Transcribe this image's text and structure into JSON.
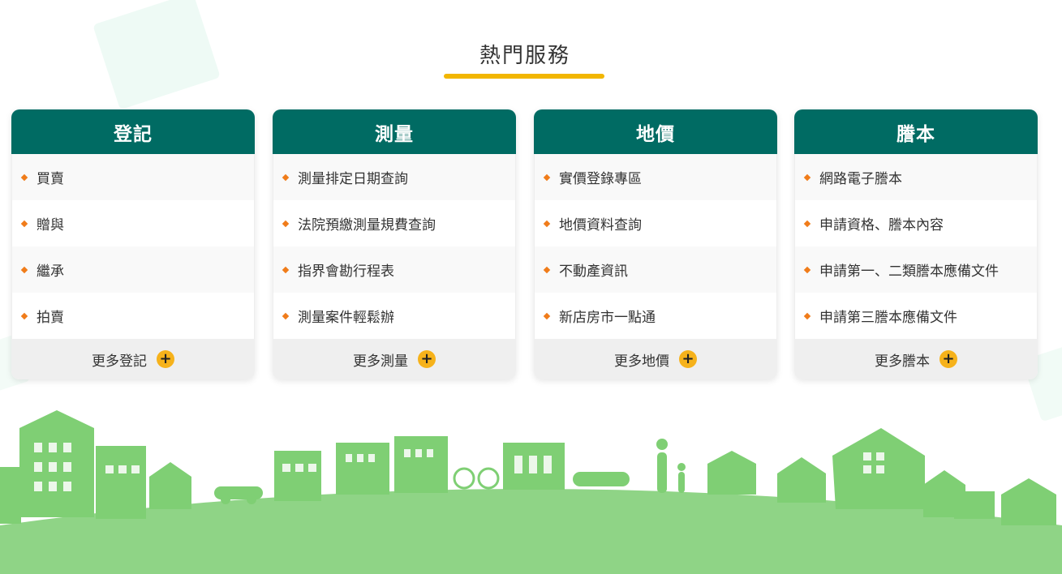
{
  "section": {
    "title": "熱門服務"
  },
  "colors": {
    "header": "#006b63",
    "accent": "#f2b600",
    "bullet": "#f07c1a",
    "plus": "#f6b21b"
  },
  "cards": [
    {
      "title": "登記",
      "items": [
        "買賣",
        "贈與",
        "繼承",
        "拍賣"
      ],
      "more": "更多登記"
    },
    {
      "title": "測量",
      "items": [
        "測量排定日期查詢",
        "法院預繳測量規費查詢",
        "指界會勘行程表",
        "測量案件輕鬆辦"
      ],
      "more": "更多測量"
    },
    {
      "title": "地價",
      "items": [
        "實價登錄專區",
        "地價資料查詢",
        "不動產資訊",
        "新店房市一點通"
      ],
      "more": "更多地價"
    },
    {
      "title": "謄本",
      "items": [
        "網路電子謄本",
        "申請資格、謄本內容",
        "申請第一、二類謄本應備文件",
        "申請第三謄本應備文件"
      ],
      "more": "更多謄本"
    }
  ],
  "icons": {
    "bullet": "diamond-bullet-icon",
    "more": "plus-circle-icon"
  }
}
